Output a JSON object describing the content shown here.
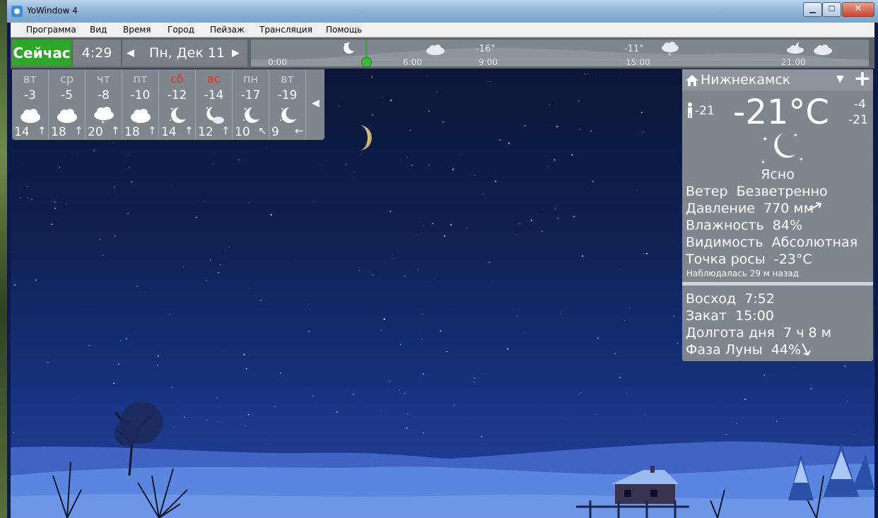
{
  "window": {
    "title": "YoWindow 4",
    "buttons": {
      "minimize": "▁",
      "maximize": "☐",
      "close": "✕"
    }
  },
  "menu": [
    "Программа",
    "Вид",
    "Время",
    "Город",
    "Пейзаж",
    "Трансляция",
    "Помощь"
  ],
  "topbar": {
    "now_label": "Сейчас",
    "time": "4:29",
    "date": "Пн, Дек 11",
    "prev_glyph": "◀",
    "next_glyph": "▶"
  },
  "timeline": {
    "hours": [
      "0:00",
      "6:00",
      "9:00",
      "15:00",
      "21:00"
    ],
    "temps": [
      "-16°",
      "-11°"
    ],
    "icons": [
      "moon-icon",
      "cloud-icon",
      "snow-cloud-icon",
      "moon-cloud-icon",
      "cloud-icon"
    ],
    "current_hour_fraction": 0.187
  },
  "forecast": {
    "collapse_glyph": "◀",
    "days": [
      {
        "name": "вт",
        "temp": "-3",
        "icon": "cloud-icon",
        "wind": "14",
        "dir": "↑",
        "weekend": false
      },
      {
        "name": "ср",
        "temp": "-5",
        "icon": "cloud-icon",
        "wind": "18",
        "dir": "↑",
        "weekend": false
      },
      {
        "name": "чт",
        "temp": "-8",
        "icon": "snow-cloud-icon",
        "wind": "20",
        "dir": "↑",
        "weekend": false
      },
      {
        "name": "пт",
        "temp": "-10",
        "icon": "cloud-icon",
        "wind": "18",
        "dir": "↑",
        "weekend": false
      },
      {
        "name": "сб",
        "temp": "-12",
        "icon": "moon-icon",
        "wind": "14",
        "dir": "↑",
        "weekend": true
      },
      {
        "name": "вс",
        "temp": "-14",
        "icon": "moon-cloud-icon",
        "wind": "12",
        "dir": "↑",
        "weekend": true
      },
      {
        "name": "пн",
        "temp": "-17",
        "icon": "moon-icon",
        "wind": "10",
        "dir": "↖",
        "weekend": false
      },
      {
        "name": "вт",
        "temp": "-19",
        "icon": "moon-icon",
        "wind": "9",
        "dir": "←",
        "weekend": false
      }
    ]
  },
  "panel": {
    "city": "Нижнекамск",
    "dropdown_glyph": "▼",
    "add_glyph": "+",
    "feels_like": "-21",
    "temp": "-21°C",
    "max": "-4",
    "min": "-21",
    "condition": "Ясно",
    "details": [
      {
        "label": "Ветер",
        "value": "Безветренно"
      },
      {
        "label": "Давление",
        "value": "770 мм"
      },
      {
        "label": "Влажность",
        "value": "84%"
      },
      {
        "label": "Видимость",
        "value": "Абсолютная"
      },
      {
        "label": "Точка росы",
        "value": "-23°C"
      }
    ],
    "observed": "Наблюдалась 29 м назад",
    "astro": [
      {
        "label": "Восход",
        "value": "7:52"
      },
      {
        "label": "Закат",
        "value": "15:00"
      },
      {
        "label": "Долгота дня",
        "value": "7 ч 8 м"
      },
      {
        "label": "Фаза Луны",
        "value": "44%"
      }
    ]
  },
  "colors": {
    "now_green": "#2fa52a",
    "panel_gray": "#80868d",
    "weekend_red": "#e0352b",
    "sky_top": "#0a1433",
    "sky_bottom": "#2242a0",
    "snow": "#5b86e0"
  }
}
